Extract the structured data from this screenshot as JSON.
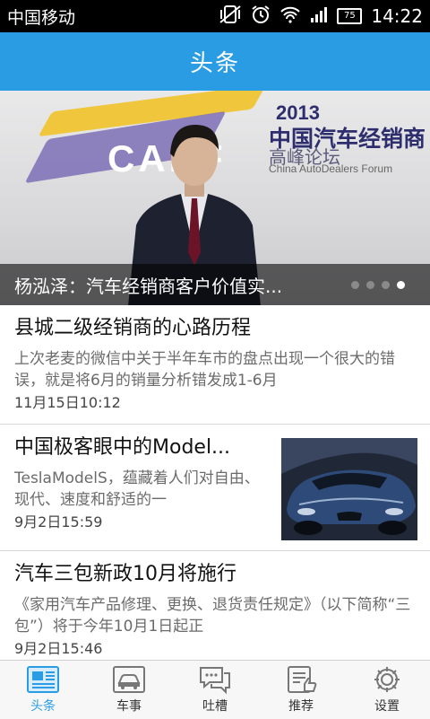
{
  "status_bar": {
    "carrier": "中国移动",
    "battery": "75",
    "time": "14:22"
  },
  "app_bar": {
    "title": "头条"
  },
  "hero": {
    "banner": {
      "year": "2013",
      "logo": "CADF",
      "cn_line1": "中国汽车经销商",
      "cn_line2": "高峰论坛",
      "en_line": "China AutoDealers Forum"
    },
    "caption": "杨泓泽：汽车经销商客户价值实...",
    "slide_count": 4,
    "active_slide": 4
  },
  "news": [
    {
      "title": "县城二级经销商的心路历程",
      "summary": "上次老麦的微信中关于半年车市的盘点出现一个很大的错误，就是将6月的销量分析错发成1-6月",
      "time": "11月15日10:12"
    },
    {
      "title": "中国极客眼中的Model...",
      "summary": "TeslaModelS，蕴藏着人们对自由、现代、速度和舒适的一",
      "time": "9月2日15:59",
      "thumbnail": "car-photo"
    },
    {
      "title": "汽车三包新政10月将施行",
      "summary": "《家用汽车产品修理、更换、退货责任规定》（以下简称“三包”）将于今年10月1日起正",
      "time": "9月2日15:46"
    }
  ],
  "bottom_nav": [
    {
      "label": "头条",
      "icon": "newspaper-icon",
      "active": true
    },
    {
      "label": "车事",
      "icon": "car-icon",
      "active": false
    },
    {
      "label": "吐槽",
      "icon": "chat-bubbles-icon",
      "active": false
    },
    {
      "label": "推荐",
      "icon": "recommend-icon",
      "active": false
    },
    {
      "label": "设置",
      "icon": "gear-icon",
      "active": false
    }
  ],
  "colors": {
    "accent": "#2a9ce3",
    "status_bar": "#000000"
  }
}
